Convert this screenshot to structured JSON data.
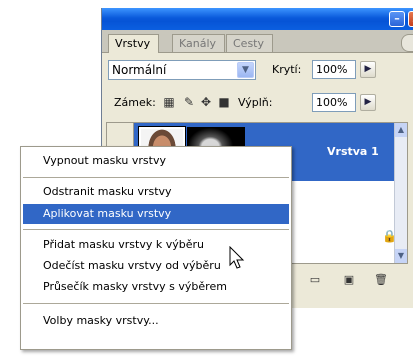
{
  "panel": {
    "tabs": [
      "Vrstvy",
      "Kanály",
      "Cesty"
    ],
    "blend_mode": "Normální",
    "opacity_label": "Krytí:",
    "opacity_value": "100%",
    "lock_label": "Zámek:",
    "fill_label": "Výplň:",
    "fill_value": "100%",
    "layer_name": "Vrstva 1"
  },
  "menu": {
    "items": [
      "Vypnout masku vrstvy",
      "Odstranit masku vrstvy",
      "Aplikovat masku vrstvy",
      "Přidat masku vrstvy k výběru",
      "Odečíst masku vrstvy od výběru",
      "Průsečík masky vrstvy s výběrem",
      "Volby masky vrstvy..."
    ],
    "selected_index": 2
  },
  "colors": {
    "selection": "#3167c6",
    "panel_bg": "#ece9d8",
    "titlebar": "#0a59db"
  },
  "icons": {
    "lock_transparency": "checker-icon",
    "lock_paint": "brush-icon",
    "lock_move": "move-icon",
    "lock_all": "lock-icon",
    "cursor": "arrow-cursor-icon"
  }
}
